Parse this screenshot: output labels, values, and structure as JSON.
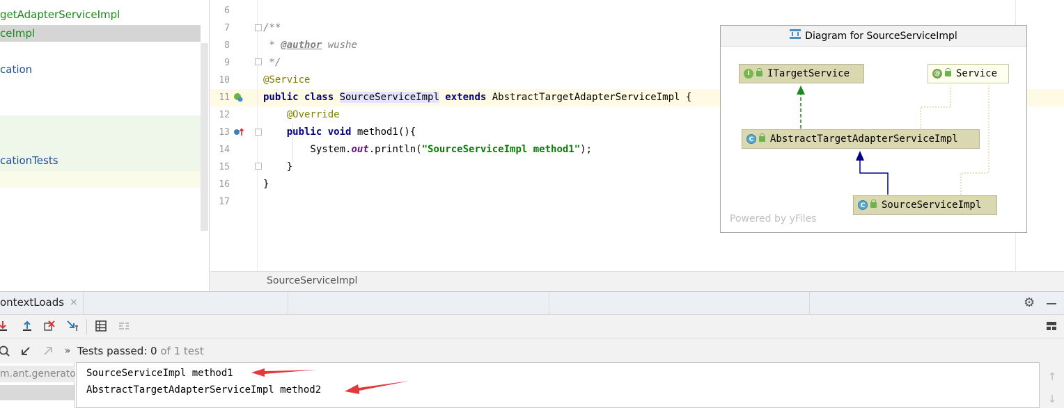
{
  "project_tree": {
    "items": [
      {
        "label": "getAdapterServiceImpl",
        "style": "green"
      },
      {
        "label": "ceImpl",
        "style": "green-selected"
      },
      {
        "label": "cation",
        "style": "blue"
      },
      {
        "label": "cationTests",
        "style": "blue"
      }
    ]
  },
  "editor": {
    "line_numbers": [
      "6",
      "7",
      "8",
      "9",
      "10",
      "11",
      "12",
      "13",
      "14",
      "15",
      "16",
      "17"
    ],
    "code": {
      "l7": "/**",
      "l8_prefix": " * ",
      "l8_tag": "@author",
      "l8_name": " wushe",
      "l9": " */",
      "l10": "@Service",
      "l11_kw": "public class ",
      "l11_cls": "SourceServiceImpl",
      "l11_ext": " extends ",
      "l11_parent": "AbstractTargetAdapterServiceImpl {",
      "l12": "    @Override",
      "l13_kw": "    public void ",
      "l13_rest": "method1(){",
      "l14_a": "        System.",
      "l14_field": "out",
      "l14_b": ".println(",
      "l14_str": "\"SourceServiceImpl method1\"",
      "l14_c": ");",
      "l15": "    }",
      "l16": "}"
    },
    "breadcrumb": "SourceServiceImpl"
  },
  "diagram": {
    "title": "Diagram for SourceServiceImpl",
    "nodes": {
      "itarget": {
        "label": "ITargetService",
        "badge": "I"
      },
      "service": {
        "label": "Service",
        "badge": "@"
      },
      "abstract": {
        "label": "AbstractTargetAdapterServiceImpl",
        "badge": "C"
      },
      "source": {
        "label": "SourceServiceImpl",
        "badge": "C"
      }
    },
    "powered_by": "Powered by yFiles",
    "colors": {
      "implements": "#1a8a1a",
      "extends": "#00008b",
      "annotation": "#c8c8a0"
    }
  },
  "run_window": {
    "tab_label": "ontextLoads",
    "tab_close": "×",
    "status_prefix": "Tests passed: ",
    "status_count": "0",
    "status_rest": " of 1 test",
    "tree_item": "m.ant.generato",
    "output": [
      "SourceServiceImpl method1",
      "AbstractTargetAdapterServiceImpl method2"
    ]
  }
}
